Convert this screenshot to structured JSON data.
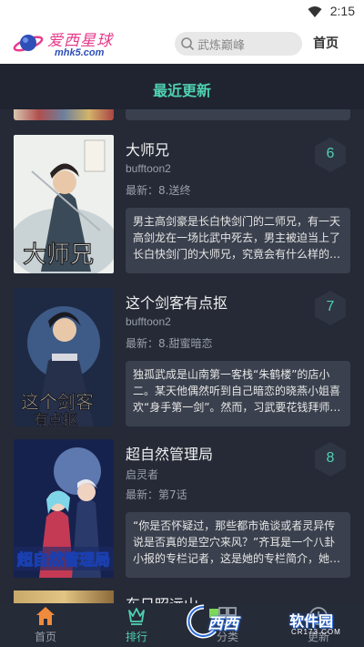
{
  "status": {
    "time": "2:15",
    "wifi_icon": "wifi-icon"
  },
  "header": {
    "logo_text": "爱西星球",
    "logo_url": "mhk5.com",
    "search_placeholder": "武炼巅峰",
    "home_link": "首页"
  },
  "section": {
    "title": "最近更新"
  },
  "comics": [
    {
      "name": "大师兄",
      "author": "bufftoon2",
      "latest": "最新：8.送终",
      "rank": "6",
      "description": "男主高剑豪是长白快剑门的二师兄，有一天高剑龙在一场比武中死去，男主被迫当上了长白快剑门的大师兄，究竟会有什么样的…"
    },
    {
      "name": "这个剑客有点抠",
      "author": "bufftoon2",
      "latest": "最新：8.甜蜜暗恋",
      "rank": "7",
      "description": "独孤武成是山南第一客栈“朱鹤楼”的店小二。某天他偶然听到自己暗恋的晓燕小姐喜欢“身手第一剑”。然而，习武要花钱拜师…"
    },
    {
      "name": "超自然管理局",
      "author": "启灵者",
      "latest": "最新：第7话",
      "rank": "8",
      "description": "“你是否怀疑过，那些都市诡谈或者灵异传说是否真的是空穴来风？”齐耳是一个八卦小报的专栏记者，这是她的专栏简介，她…"
    }
  ],
  "partial_comic": {
    "name": "东日昭远山"
  },
  "tabs": [
    {
      "label": "首页",
      "icon": "home-icon",
      "active": false
    },
    {
      "label": "排行",
      "icon": "ranking-icon",
      "active": true
    },
    {
      "label": "分类",
      "icon": "category-icon",
      "active": false
    },
    {
      "label": "更新",
      "icon": "update-icon",
      "active": false
    }
  ],
  "watermark": {
    "text1": "西西",
    "text2": "软件园",
    "text3": "CR173.COM"
  },
  "colors": {
    "accent": "#4fd1b0",
    "background": "#252a36",
    "card_bg": "#3a404d"
  }
}
